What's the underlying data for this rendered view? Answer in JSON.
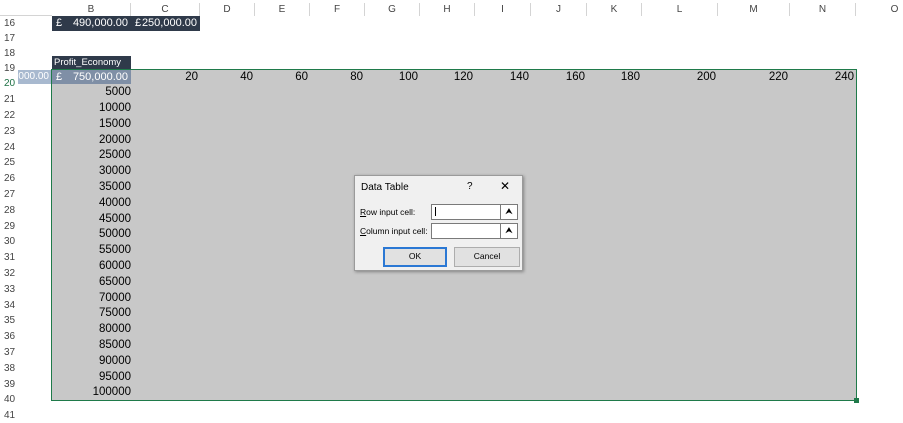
{
  "columns": [
    "B",
    "C",
    "D",
    "E",
    "F",
    "G",
    "H",
    "I",
    "J",
    "K",
    "L",
    "M",
    "N",
    "O"
  ],
  "rows": [
    "16",
    "17",
    "18",
    "19",
    "20",
    "21",
    "22",
    "23",
    "24",
    "25",
    "26",
    "27",
    "28",
    "29",
    "30",
    "31",
    "32",
    "33",
    "34",
    "35",
    "36",
    "37",
    "38",
    "39",
    "40",
    "41"
  ],
  "row16": {
    "b_currency": "£",
    "b_value": "490,000.00",
    "c_currency": "£",
    "c_value": "250,000.00"
  },
  "row19": {
    "label": "Profit_Economy"
  },
  "row20": {
    "a_value": "000.00",
    "b_currency": "£",
    "b_value": "750,000.00"
  },
  "column_inputs": [
    "20",
    "40",
    "60",
    "80",
    "100",
    "120",
    "140",
    "160",
    "180",
    "200",
    "220",
    "240"
  ],
  "row_inputs": [
    "5000",
    "10000",
    "15000",
    "20000",
    "25000",
    "30000",
    "35000",
    "40000",
    "45000",
    "50000",
    "55000",
    "60000",
    "65000",
    "70000",
    "75000",
    "80000",
    "85000",
    "90000",
    "95000",
    "100000"
  ],
  "dialog": {
    "title": "Data Table",
    "help": "?",
    "close": "✕",
    "row_label_accel": "R",
    "row_label_rest": "ow input cell:",
    "col_label_accel": "C",
    "col_label_rest": "olumn input cell:",
    "picker_glyph": "⮝",
    "ok": "OK",
    "cancel": "Cancel"
  },
  "colors": {
    "selection_border": "#1f7a4a",
    "selection_fill": "#c8c8c8",
    "dark_cell": "#2f3a4a",
    "ok_border": "#2b78d4"
  }
}
